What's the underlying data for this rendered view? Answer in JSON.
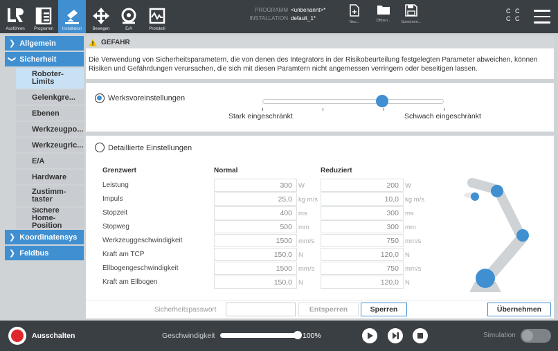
{
  "topbar": {
    "tabs": [
      {
        "label": "Ausführen",
        "icon": "ur-logo-icon"
      },
      {
        "label": "Programm",
        "icon": "program-icon"
      },
      {
        "label": "Installation",
        "icon": "installation-icon"
      },
      {
        "label": "Bewegen",
        "icon": "move-icon"
      },
      {
        "label": "E/A",
        "icon": "io-icon"
      },
      {
        "label": "Protokoll",
        "icon": "log-icon"
      }
    ],
    "program_label": "PROGRAMM",
    "program_value": "<unbenannt>*",
    "installation_label": "INSTALLATION",
    "installation_value": "default_1*",
    "file_buttons": [
      {
        "label": "Neu...",
        "icon": "new-file-icon"
      },
      {
        "label": "Öffnen...",
        "icon": "folder-icon"
      },
      {
        "label": "Speichern...",
        "icon": "save-icon"
      }
    ],
    "cc_label": "C C\nC C"
  },
  "nav": {
    "sections": [
      {
        "label": "Allgemein",
        "expanded": false
      },
      {
        "label": "Sicherheit",
        "expanded": true
      },
      {
        "label": "Koordinatensys",
        "expanded": false
      },
      {
        "label": "Feldbus",
        "expanded": false
      }
    ],
    "sicherheit_items": [
      "Roboter-Limits",
      "Gelenkgre...",
      "Ebenen",
      "Werkzeugpo...",
      "Werkzeugric...",
      "E/A",
      "Hardware",
      "Zustimm-taster",
      "Sichere Home-Position"
    ]
  },
  "main": {
    "danger_title": "GEFAHR",
    "danger_text": "Die Verwendung von Sicherheitsparametern, die von denen des Integrators in der Risikobeurteilung festgelegten Parameter abweichen, können Risiken und Gefährdungen verursachen, die sich mit diesen Paramtern nicht angemessen verringern oder beseitigen lassen.",
    "factory_label": "Werksvoreinstellungen",
    "slider_left": "Stark eingeschränkt",
    "slider_right": "Schwach eingeschränkt",
    "slider_value": 0.66,
    "detailed_label": "Detaillierte Einstellungen",
    "table": {
      "headers": [
        "Grenzwert",
        "Normal",
        "Reduziert"
      ],
      "rows": [
        {
          "name": "Leistung",
          "normal": "300",
          "reduced": "200",
          "unit": "W"
        },
        {
          "name": "Impuls",
          "normal": "25,0",
          "reduced": "10,0",
          "unit": "kg m/s"
        },
        {
          "name": "Stopzeit",
          "normal": "400",
          "reduced": "300",
          "unit": "ms"
        },
        {
          "name": "Stopweg",
          "normal": "500",
          "reduced": "300",
          "unit": "mm"
        },
        {
          "name": "Werkzeuggeschwindigkeit",
          "normal": "1500",
          "reduced": "750",
          "unit": "mm/s"
        },
        {
          "name": "Kraft am TCP",
          "normal": "150,0",
          "reduced": "120,0",
          "unit": "N"
        },
        {
          "name": "Ellbogengeschwindigkeit",
          "normal": "1500",
          "reduced": "750",
          "unit": "mm/s"
        },
        {
          "name": "Kraft am Ellbogen",
          "normal": "150,0",
          "reduced": "120,0",
          "unit": "N"
        }
      ]
    },
    "password_label": "Sicherheitspasswort",
    "unlock_label": "Entsperren",
    "lock_label": "Sperren",
    "apply_label": "Übernehmen"
  },
  "footer": {
    "power_label": "Ausschalten",
    "speed_label": "Geschwindigkeit",
    "speed_value": "100%",
    "speed_fraction": 1.0,
    "simulation_label": "Simulation"
  },
  "colors": {
    "accent": "#3f8fd1",
    "bar": "#3a3f44",
    "danger": "#e0262b",
    "warning": "#f5c400"
  }
}
